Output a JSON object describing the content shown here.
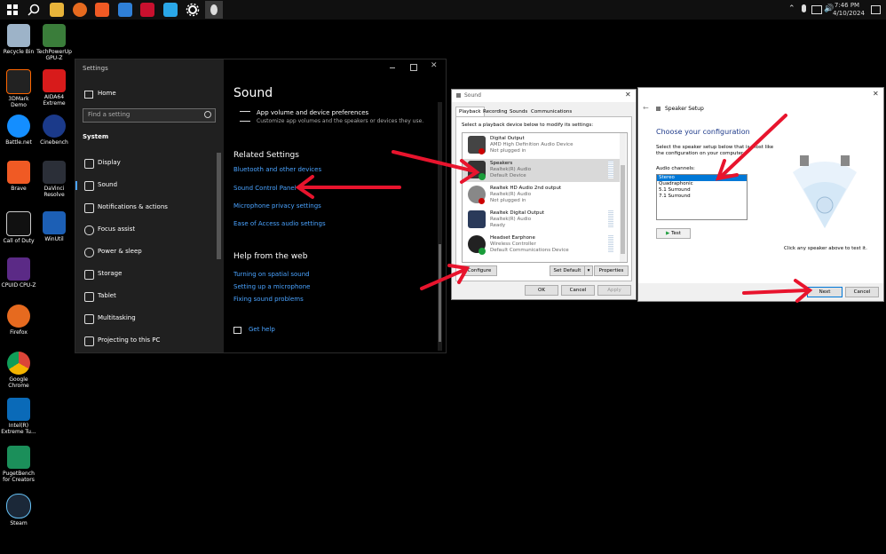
{
  "taskbar": {
    "time": "7:46 PM",
    "date": "4/10/2024"
  },
  "desktop": {
    "icons": [
      {
        "label": "Recycle Bin"
      },
      {
        "label": "TechPowerUp GPU-Z"
      },
      {
        "label": "3DMark Demo"
      },
      {
        "label": "AIDA64 Extreme"
      },
      {
        "label": "Battle.net"
      },
      {
        "label": "Cinebench"
      },
      {
        "label": "Brave"
      },
      {
        "label": "DaVinci Resolve"
      },
      {
        "label": "Call of Duty"
      },
      {
        "label": "WinUtil"
      },
      {
        "label": "CPUID CPU-Z"
      },
      {
        "label": "Firefox"
      },
      {
        "label": "Google Chrome"
      },
      {
        "label": "Intel(R) Extreme Tu..."
      },
      {
        "label": "PugetBench for Creators"
      },
      {
        "label": "Steam"
      }
    ]
  },
  "settings": {
    "window_title": "Settings",
    "home": "Home",
    "search_placeholder": "Find a setting",
    "section": "System",
    "nav": [
      {
        "label": "Display"
      },
      {
        "label": "Sound"
      },
      {
        "label": "Notifications & actions"
      },
      {
        "label": "Focus assist"
      },
      {
        "label": "Power & sleep"
      },
      {
        "label": "Storage"
      },
      {
        "label": "Tablet"
      },
      {
        "label": "Multitasking"
      },
      {
        "label": "Projecting to this PC"
      }
    ],
    "page_title": "Sound",
    "app_volume_title": "App volume and device preferences",
    "app_volume_desc": "Customize app volumes and the speakers or devices they use.",
    "related_title": "Related Settings",
    "related_links": [
      {
        "label": "Bluetooth and other devices"
      },
      {
        "label": "Sound Control Panel"
      },
      {
        "label": "Microphone privacy settings"
      },
      {
        "label": "Ease of Access audio settings"
      }
    ],
    "help_title": "Help from the web",
    "help_links": [
      {
        "label": "Turning on spatial sound"
      },
      {
        "label": "Setting up a microphone"
      },
      {
        "label": "Fixing sound problems"
      }
    ],
    "get_help": "Get help"
  },
  "sound_dialog": {
    "title": "Sound",
    "tabs": [
      {
        "label": "Playback"
      },
      {
        "label": "Recording"
      },
      {
        "label": "Sounds"
      },
      {
        "label": "Communications"
      }
    ],
    "instruction": "Select a playback device below to modify its settings:",
    "devices": [
      {
        "name": "Digital Output",
        "driver": "AMD High Definition Audio Device",
        "status": "Not plugged in"
      },
      {
        "name": "Speakers",
        "driver": "Realtek(R) Audio",
        "status": "Default Device"
      },
      {
        "name": "Realtek HD Audio 2nd output",
        "driver": "Realtek(R) Audio",
        "status": "Not plugged in"
      },
      {
        "name": "Realtek Digital Output",
        "driver": "Realtek(R) Audio",
        "status": "Ready"
      },
      {
        "name": "Headset Earphone",
        "driver": "Wireless Controller",
        "status": "Default Communications Device"
      }
    ],
    "configure": "Configure",
    "set_default": "Set Default",
    "properties": "Properties",
    "ok": "OK",
    "cancel": "Cancel",
    "apply": "Apply"
  },
  "speaker_setup": {
    "title": "Speaker Setup",
    "heading": "Choose your configuration",
    "desc_line1": "Select the speaker setup below that is most like",
    "desc_line2": "the configuration on your computer.",
    "channels_label": "Audio channels:",
    "channels": [
      {
        "label": "Stereo"
      },
      {
        "label": "Quadraphonic"
      },
      {
        "label": "5.1 Surround"
      },
      {
        "label": "7.1 Surround"
      }
    ],
    "test": "Test",
    "hint": "Click any speaker above to test it.",
    "next": "Next",
    "cancel": "Cancel"
  },
  "colors": {
    "accent": "#4aa3ff",
    "arrow": "#e8142d",
    "selection": "#0078d7"
  }
}
